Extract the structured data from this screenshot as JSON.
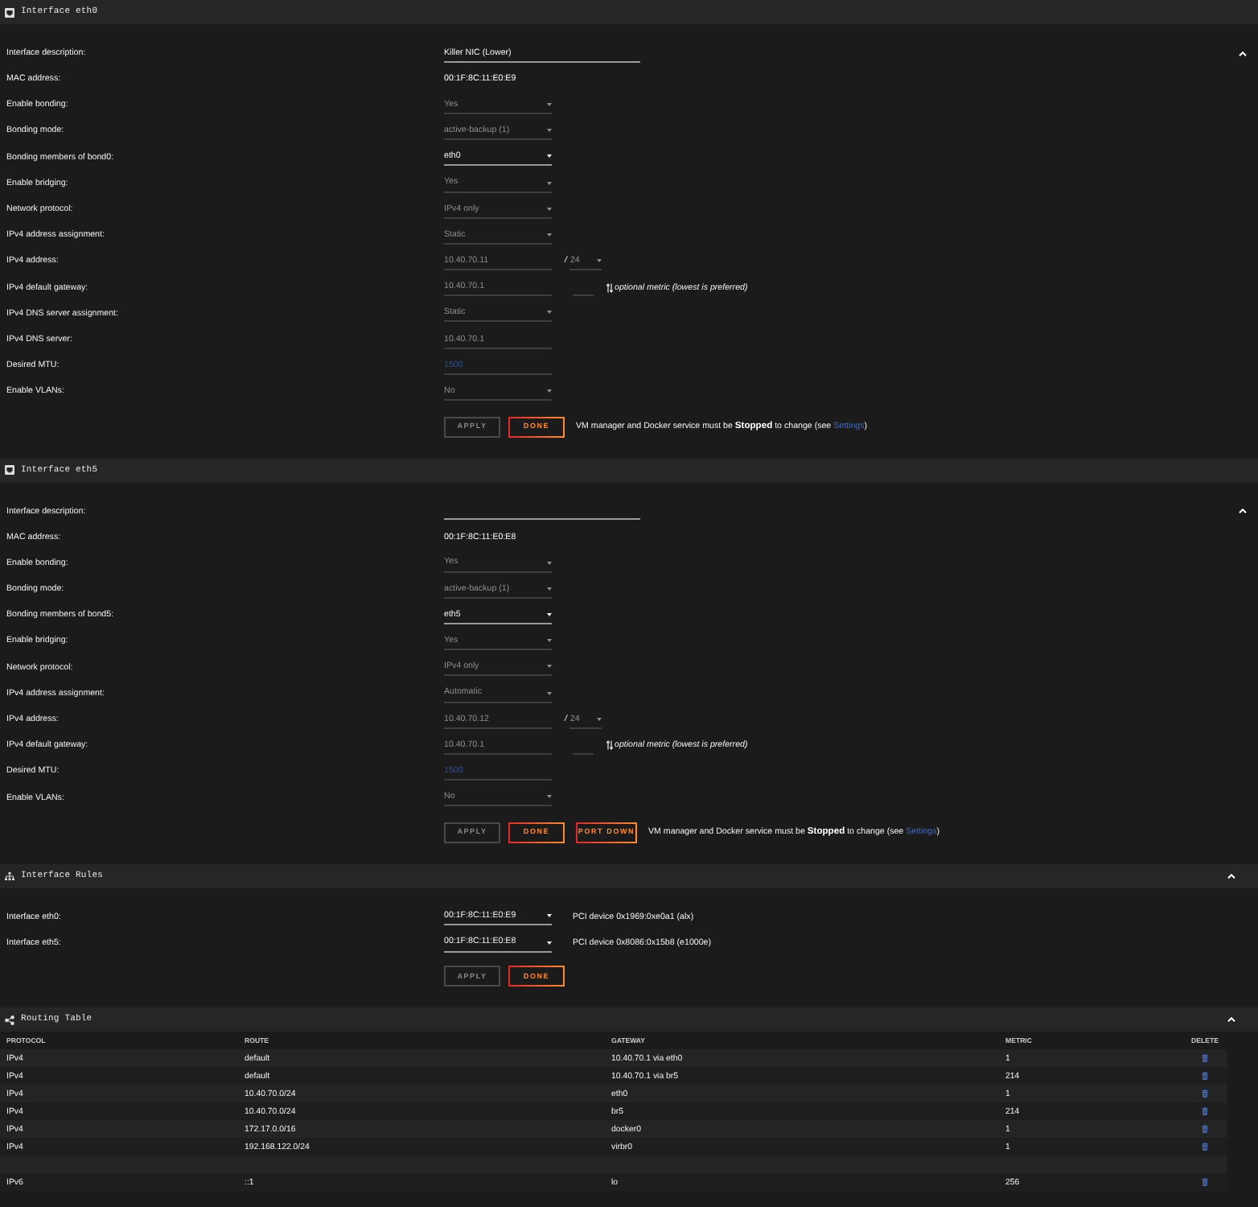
{
  "sections": [
    {
      "kind": "interface",
      "title": "Interface eth0",
      "fields": [
        {
          "label": "Interface description:",
          "kind": "wide_input",
          "value": "Killer NIC (Lower)",
          "disabled": false
        },
        {
          "label": "MAC address:",
          "kind": "text",
          "value": "00:1F:8C:11:E0:E9"
        },
        {
          "label": "Enable bonding:",
          "kind": "select",
          "value": "Yes",
          "disabled": true
        },
        {
          "label": "Bonding mode:",
          "kind": "select",
          "value": "active-backup (1)",
          "disabled": true
        },
        {
          "label": "Bonding members of bond0:",
          "kind": "select",
          "value": "eth0",
          "disabled": false
        },
        {
          "label": "Enable bridging:",
          "kind": "select",
          "value": "Yes",
          "disabled": true
        },
        {
          "label": "Network protocol:",
          "kind": "select",
          "value": "IPv4 only",
          "disabled": true
        },
        {
          "label": "IPv4 address assignment:",
          "kind": "select",
          "value": "Static",
          "disabled": true
        },
        {
          "label": "IPv4 address:",
          "kind": "address",
          "value": "10.40.70.11",
          "separator": "/",
          "netmask": "24",
          "disabled": true
        },
        {
          "label": "IPv4 default gateway:",
          "kind": "gateway",
          "value": "10.40.70.1",
          "hint": "optional metric (lowest is preferred)",
          "disabled": true
        },
        {
          "label": "IPv4 DNS server assignment:",
          "kind": "select",
          "value": "Static",
          "disabled": true
        },
        {
          "label": "IPv4 DNS server:",
          "kind": "input",
          "value": "10.40.70.1",
          "disabled": true
        },
        {
          "label": "Desired MTU:",
          "kind": "input",
          "placeholder": "1500",
          "disabled": true
        },
        {
          "label": "Enable VLANs:",
          "kind": "select",
          "value": "No",
          "disabled": true
        }
      ],
      "buttons": [
        {
          "label": "APPLY",
          "disabled": true
        },
        {
          "label": "DONE",
          "disabled": false
        }
      ],
      "note": {
        "text": "VM manager and Docker service must be **Stopped** to change (see",
        "link": "Settings",
        "end": ")"
      }
    },
    {
      "kind": "interface",
      "title": "Interface eth5",
      "fields": [
        {
          "label": "Interface description:",
          "kind": "wide_input",
          "disabled": false
        },
        {
          "label": "MAC address:",
          "kind": "text",
          "value": "00:1F:8C:11:E0:E8"
        },
        {
          "label": "Enable bonding:",
          "kind": "select",
          "value": "Yes",
          "disabled": true
        },
        {
          "label": "Bonding mode:",
          "kind": "select",
          "value": "active-backup (1)",
          "disabled": true
        },
        {
          "label": "Bonding members of bond5:",
          "kind": "select",
          "value": "eth5",
          "disabled": false
        },
        {
          "label": "Enable bridging:",
          "kind": "select",
          "value": "Yes",
          "disabled": true
        },
        {
          "label": "Network protocol:",
          "kind": "select",
          "value": "IPv4 only",
          "disabled": true
        },
        {
          "label": "IPv4 address assignment:",
          "kind": "select",
          "value": "Automatic",
          "disabled": true
        },
        {
          "label": "IPv4 address:",
          "kind": "address",
          "value": "10.40.70.12",
          "separator": "/",
          "netmask": "24",
          "disabled": true
        },
        {
          "label": "IPv4 default gateway:",
          "kind": "gateway",
          "value": "10.40.70.1",
          "hint": "optional metric (lowest is preferred)",
          "disabled": true
        },
        {
          "label": "Desired MTU:",
          "kind": "input",
          "placeholder": "1500",
          "disabled": true
        },
        {
          "label": "Enable VLANs:",
          "kind": "select",
          "value": "No",
          "disabled": true
        }
      ],
      "buttons": [
        {
          "label": "APPLY",
          "disabled": true
        },
        {
          "label": "DONE",
          "disabled": false
        },
        {
          "label": "PORT DOWN",
          "disabled": false
        }
      ],
      "note": {
        "text": "VM manager and Docker service must be **Stopped** to change (see",
        "link": "Settings",
        "end": ")"
      }
    },
    {
      "kind": "rules",
      "title": "Interface Rules",
      "rules": [
        {
          "label": "Interface eth0:",
          "value": "00:1F:8C:11:E0:E9",
          "device": "PCI device 0x1969:0xe0a1 (alx)"
        },
        {
          "label": "Interface eth5:",
          "value": "00:1F:8C:11:E0:E8",
          "device": "PCI device 0x8086:0x15b8 (e1000e)"
        }
      ],
      "buttons": [
        {
          "label": "APPLY",
          "disabled": true
        },
        {
          "label": "DONE",
          "disabled": false
        }
      ]
    },
    {
      "kind": "routes",
      "title": "Routing Table",
      "columns": [
        "PROTOCOL",
        "ROUTE",
        "GATEWAY",
        "METRIC",
        "DELETE"
      ],
      "groups": [
        [
          [
            "IPv4",
            "default",
            "10.40.70.1 via eth0",
            "1"
          ],
          [
            "IPv4",
            "default",
            "10.40.70.1 via br5",
            "214"
          ],
          [
            "IPv4",
            "10.40.70.0/24",
            "eth0",
            "1"
          ],
          [
            "IPv4",
            "10.40.70.0/24",
            "br5",
            "214"
          ],
          [
            "IPv4",
            "172.17.0.0/16",
            "docker0",
            "1"
          ],
          [
            "IPv4",
            "192.168.122.0/24",
            "virbr0",
            "1"
          ]
        ],
        [
          [
            "IPv6",
            "::1",
            "lo",
            "256"
          ]
        ]
      ]
    }
  ]
}
